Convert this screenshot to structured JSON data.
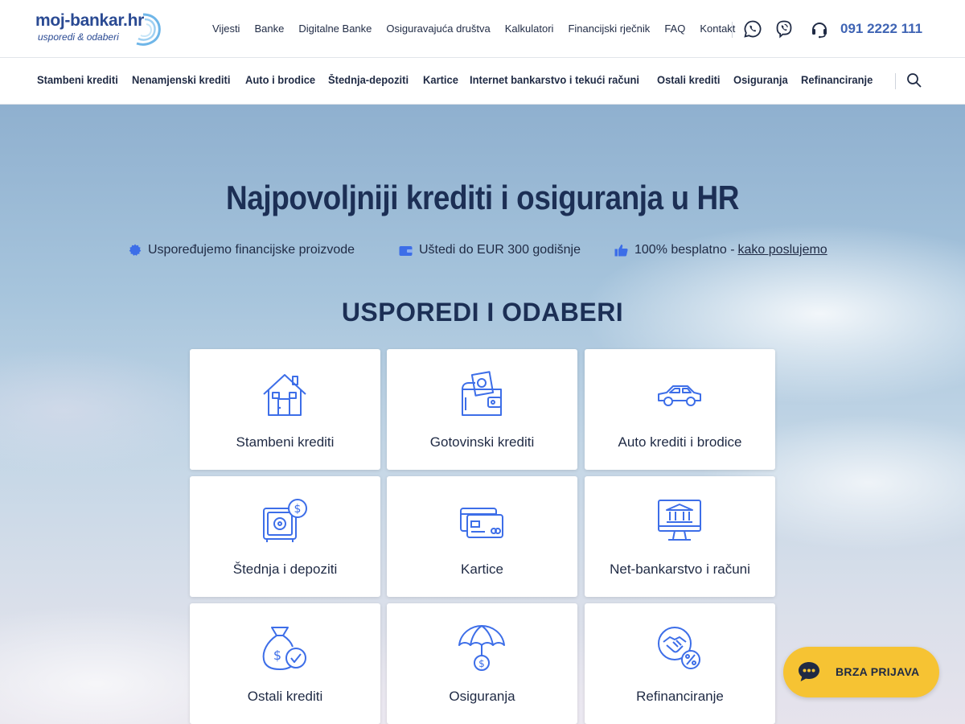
{
  "logo": {
    "main": "moj-bankar.hr",
    "sub": "usporedi & odaberi"
  },
  "topnav": [
    {
      "label": "Vijesti"
    },
    {
      "label": "Banke"
    },
    {
      "label": "Digitalne Banke"
    },
    {
      "label": "Osiguravajuća društva"
    },
    {
      "label": "Kalkulatori"
    },
    {
      "label": "Financijski rječnik"
    },
    {
      "label": "FAQ"
    },
    {
      "label": "Kontakt"
    }
  ],
  "contact": {
    "phone": "091 2222 111",
    "icons": [
      "whatsapp-icon",
      "viber-icon",
      "headset-icon"
    ]
  },
  "catnav": [
    {
      "label": "Stambeni krediti"
    },
    {
      "label": "Nenamjenski krediti"
    },
    {
      "label": "Auto i brodice"
    },
    {
      "label": "Štednja-depoziti"
    },
    {
      "label": "Kartice"
    },
    {
      "label": "Internet bankarstvo i tekući računi"
    },
    {
      "label": "Ostali krediti"
    },
    {
      "label": "Osiguranja"
    },
    {
      "label": "Refinanciranje"
    }
  ],
  "hero": {
    "title": "Najpovoljniji krediti i osiguranja u HR",
    "features": [
      {
        "icon": "badge-icon",
        "text": "Uspoređujemo financijske proizvode"
      },
      {
        "icon": "wallet-icon",
        "text": "Uštedi do EUR 300 godišnje"
      },
      {
        "icon": "thumbs-up-icon",
        "text": "100% besplatno - ",
        "link": "kako poslujemo"
      }
    ],
    "section_title": "USPOREDI I ODABERI"
  },
  "cards": [
    {
      "label": "Stambeni krediti",
      "icon": "house-icon"
    },
    {
      "label": "Gotovinski krediti",
      "icon": "cash-wallet-icon"
    },
    {
      "label": "Auto krediti i brodice",
      "icon": "car-icon"
    },
    {
      "label": "Štednja i depoziti",
      "icon": "safe-icon"
    },
    {
      "label": "Kartice",
      "icon": "credit-cards-icon"
    },
    {
      "label": "Net-bankarstvo i računi",
      "icon": "online-bank-icon"
    },
    {
      "label": "Ostali krediti",
      "icon": "money-bag-icon"
    },
    {
      "label": "Osiguranja",
      "icon": "umbrella-icon"
    },
    {
      "label": "Refinanciranje",
      "icon": "handshake-percent-icon"
    }
  ],
  "quick_login": {
    "label": "BRZA PRIJAVA",
    "icon": "chat-bubble-icon"
  },
  "colors": {
    "brand": "#2a4a93",
    "accent": "#3f64b4",
    "icon_blue": "#3d6ee8",
    "cta": "#f6c333",
    "title": "#1c2f55"
  }
}
